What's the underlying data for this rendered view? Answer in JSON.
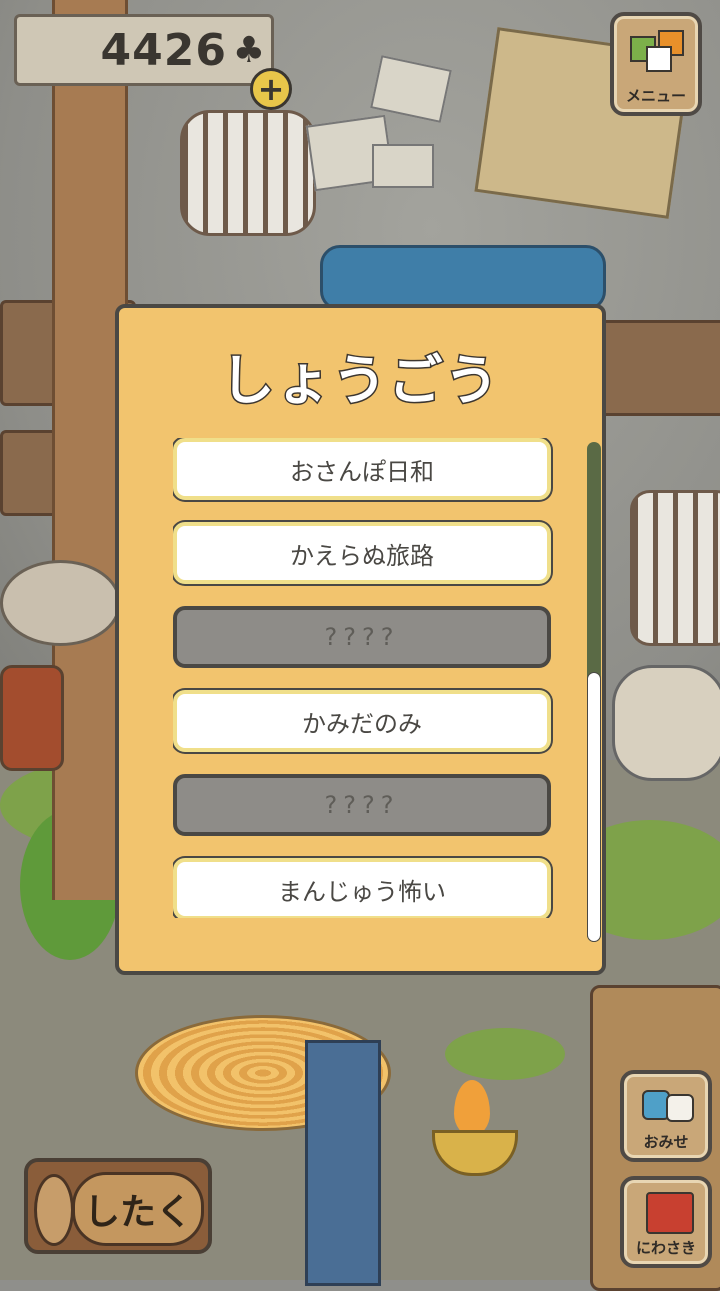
{
  "currency": {
    "value": "4426",
    "icon": "clover-icon"
  },
  "menu_button": {
    "label": "メニュー",
    "icon": "menu-icon"
  },
  "shop_button": {
    "label": "おみせ",
    "icon": "shop-icon"
  },
  "garden_button": {
    "label": "にわさき",
    "icon": "garden-icon"
  },
  "prepare_button": {
    "label": "したく"
  },
  "modal": {
    "title": "しょうごう",
    "items": [
      {
        "label": "おさんぽ日和",
        "state": "unlocked"
      },
      {
        "label": "かえらぬ旅路",
        "state": "unlocked"
      },
      {
        "label": "????",
        "state": "locked"
      },
      {
        "label": "かみだのみ",
        "state": "unlocked"
      },
      {
        "label": "????",
        "state": "locked"
      },
      {
        "label": "まんじゅう怖い",
        "state": "unlocked"
      }
    ]
  },
  "colors": {
    "panel": "#f2c46e",
    "locked": "#8e8c88",
    "accent_gold": "#e8c64a",
    "grass": "#7ea24a"
  }
}
